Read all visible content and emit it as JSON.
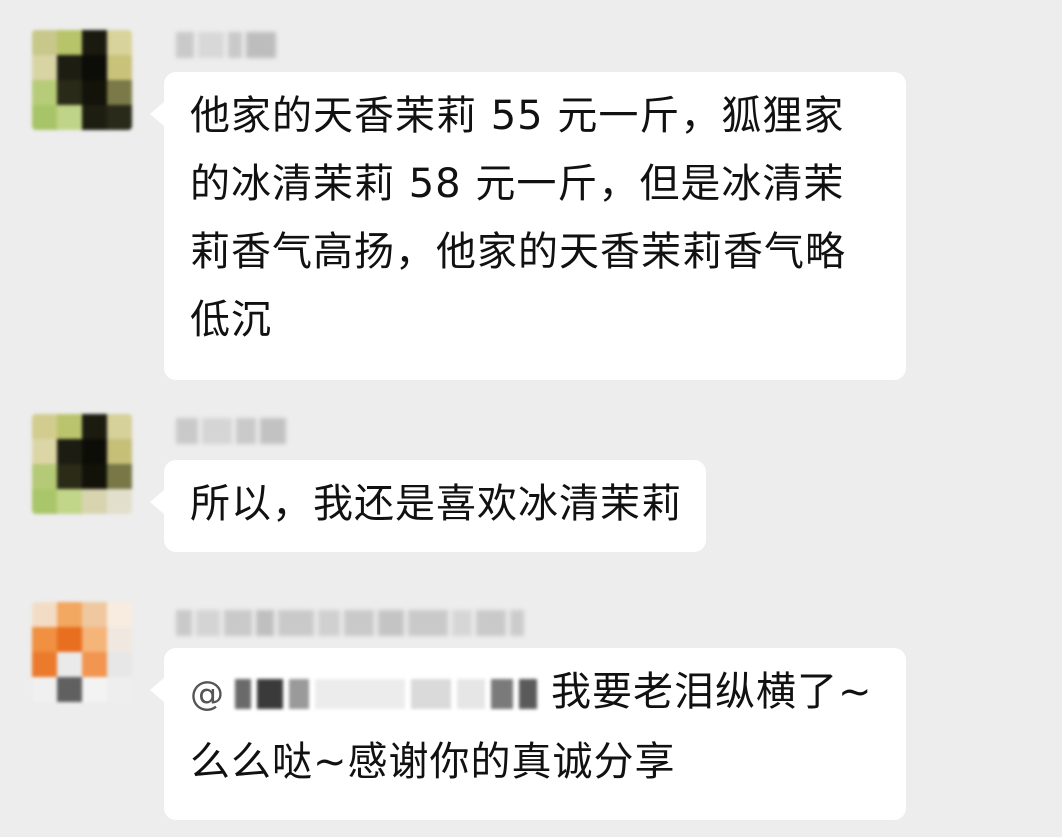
{
  "chat": {
    "messages": [
      {
        "text": "他家的天香茉莉 55 元一斤，狐狸家的冰清茉莉 58 元一斤，但是冰清茉莉香气高扬，他家的天香茉莉香气略低沉"
      },
      {
        "text": "所以，我还是喜欢冰清茉莉"
      },
      {
        "mention_symbol": "@",
        "text": "我要老泪纵横了~么么哒~感谢你的真诚分享"
      }
    ]
  },
  "icons": {
    "avatar_1": "avatar-blurred-icon",
    "avatar_2": "avatar-blurred-icon",
    "avatar_3": "avatar-blurred-icon"
  },
  "colors": {
    "background": "#ededed",
    "bubble": "#ffffff",
    "text": "#111111"
  }
}
